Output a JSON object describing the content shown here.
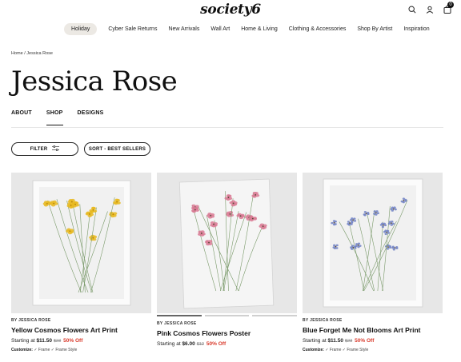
{
  "header": {
    "logo": "society6",
    "cart_count": "0",
    "icons": [
      "search-icon",
      "account-icon",
      "cart-icon"
    ]
  },
  "nav": [
    "Holiday",
    "Cyber Sale Returns",
    "New Arrivals",
    "Wall Art",
    "Home & Living",
    "Clothing & Accessories",
    "Shop By Artist",
    "Inspiration"
  ],
  "breadcrumb": "Home / Jessica Rose",
  "page_title": "Jessica Rose",
  "tabs": [
    "ABOUT",
    "SHOP",
    "DESIGNS"
  ],
  "active_tab": "SHOP",
  "filters": {
    "filter_label": "FILTER",
    "sort_label": "SORT - BEST SELLERS"
  },
  "products": [
    {
      "by": "BY JESSICA ROSE",
      "title": "Yellow Cosmos Flowers Art Print",
      "starting": "Starting at ",
      "price": "$11.50",
      "original": "$23",
      "discount": "50% Off",
      "customize_label": "Customize:",
      "customize_options": "✓ Frame  ✓ Frame Style",
      "flower_color": "#e8b81e"
    },
    {
      "by": "BY JESSICA ROSE",
      "title": "Pink Cosmos Flowers Poster",
      "starting": "Starting at ",
      "price": "$6.00",
      "original": "$12",
      "discount": "50% Off",
      "customize_label": "",
      "customize_options": "",
      "flower_color": "#d97a94"
    },
    {
      "by": "BY JESSICA ROSE",
      "title": "Blue Forget Me Not Blooms Art Print",
      "starting": "Starting at ",
      "price": "$11.50",
      "original": "$23",
      "discount": "50% Off",
      "customize_label": "Customize:",
      "customize_options": "✓ Frame  ✓ Frame Style",
      "flower_color": "#6f80c4"
    }
  ],
  "colors": {
    "discount": "#d93a2b",
    "card_bg": "#e7e7e7",
    "holiday_pill": "#ece9e4"
  }
}
